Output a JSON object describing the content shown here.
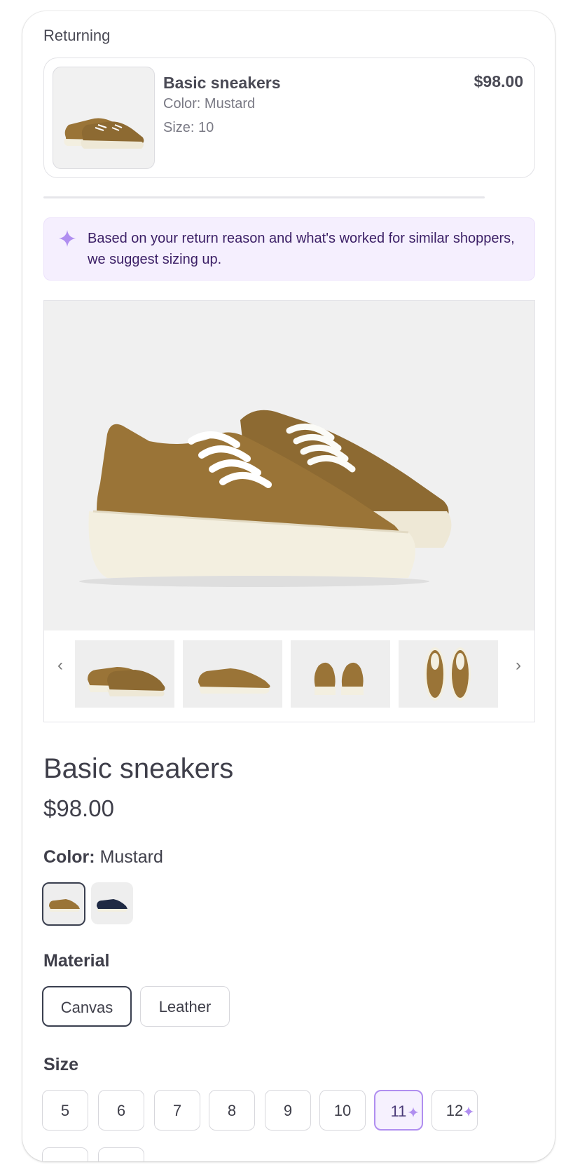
{
  "returning": {
    "section_title": "Returning",
    "product_name": "Basic sneakers",
    "price": "$98.00",
    "color": "Color: Mustard",
    "size": "Size: 10"
  },
  "suggestion": {
    "icon": "sparkle-icon",
    "text": "Based on your return reason and what's worked for similar shoppers, we suggest sizing up."
  },
  "gallery": {
    "prev_arrow": "‹",
    "next_arrow": "›",
    "thumbnail_count": 4
  },
  "product": {
    "name": "Basic sneakers",
    "price": "$98.00"
  },
  "color": {
    "label": "Color:",
    "value": "Mustard",
    "swatches": [
      "mustard",
      "navy"
    ]
  },
  "material": {
    "label": "Material",
    "options": [
      "Canvas",
      "Leather"
    ],
    "selected": "Canvas"
  },
  "size": {
    "label": "Size",
    "options": [
      "5",
      "6",
      "7",
      "8",
      "9",
      "10",
      "11",
      "12"
    ],
    "suggested": [
      "11",
      "12"
    ],
    "selected": "11"
  },
  "colors": {
    "accent_purple": "#b08ef0",
    "suggest_bg": "#f5effe",
    "suggest_text": "#3b1f66",
    "mustard": "#9a7437",
    "navy": "#1f2a44",
    "sole": "#f3efe0"
  }
}
